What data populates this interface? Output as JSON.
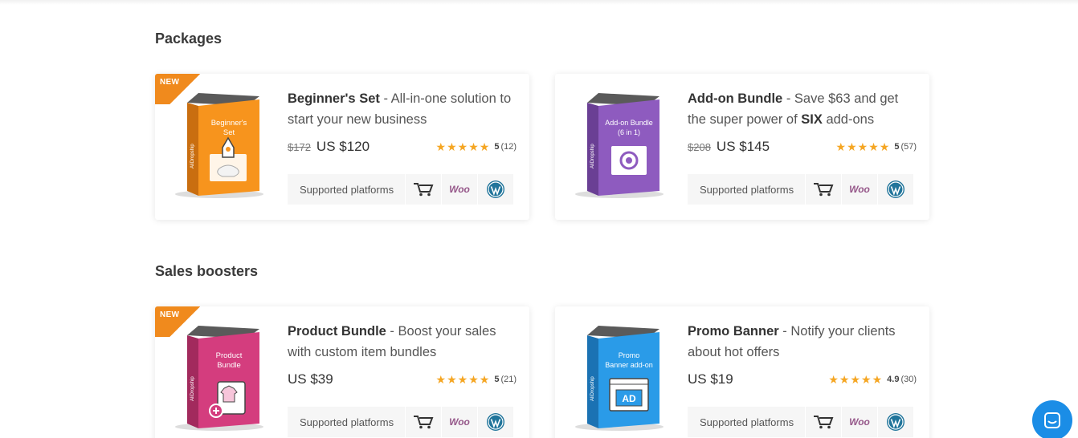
{
  "sections": [
    {
      "title": "Packages",
      "cards": [
        {
          "badge": "NEW",
          "box_lines": [
            "Beginner's",
            "Set"
          ],
          "box_color": "#f7941d",
          "name": "Beginner's Set",
          "tagline_a": " - All-in-one solution to start your new business",
          "old_price": "$172",
          "price": "US $120",
          "rating": "5",
          "reviews": "(12)",
          "platforms_label": "Supported platforms",
          "woo": "Woo"
        },
        {
          "badge": "",
          "box_lines": [
            "Add-on Bundle",
            "(6 in 1)"
          ],
          "box_color": "#8e5bbf",
          "name": "Add-on Bundle",
          "tagline_a": " - Save $63 and get the super power of ",
          "tagline_strong": "SIX",
          "tagline_b": " add-ons",
          "old_price": "$208",
          "price": "US $145",
          "rating": "5",
          "reviews": "(57)",
          "platforms_label": "Supported platforms",
          "woo": "Woo"
        }
      ]
    },
    {
      "title": "Sales boosters",
      "cards": [
        {
          "badge": "NEW",
          "box_lines": [
            "Product",
            "Bundle"
          ],
          "box_color": "#d43d7e",
          "name": "Product Bundle",
          "tagline_a": " - Boost your sales with custom item bundles",
          "old_price": "",
          "price": "US $39",
          "rating": "5",
          "reviews": "(21)",
          "platforms_label": "Supported platforms",
          "woo": "Woo"
        },
        {
          "badge": "",
          "box_lines": [
            "Promo",
            "Banner add-on"
          ],
          "box_color": "#2a9be8",
          "name": "Promo Banner",
          "tagline_a": " - Notify your clients about hot offers",
          "old_price": "",
          "price": "US $19",
          "rating": "4.9",
          "reviews": "(30)",
          "platforms_label": "Supported platforms",
          "woo": "Woo"
        }
      ]
    }
  ],
  "stars": "★★★★★",
  "box_brand": "AliDropship",
  "promo_badge_text": "AD",
  "icons": {
    "cart": "dropship-cart-icon",
    "woo": "woocommerce-icon",
    "wp": "wordpress-icon",
    "chat": "chat-icon"
  },
  "colors": {
    "ribbon": "#f08a1d",
    "stars": "#f5a623",
    "chat": "#1b8de6",
    "woo": "#96588a",
    "wp": "#21759b"
  }
}
